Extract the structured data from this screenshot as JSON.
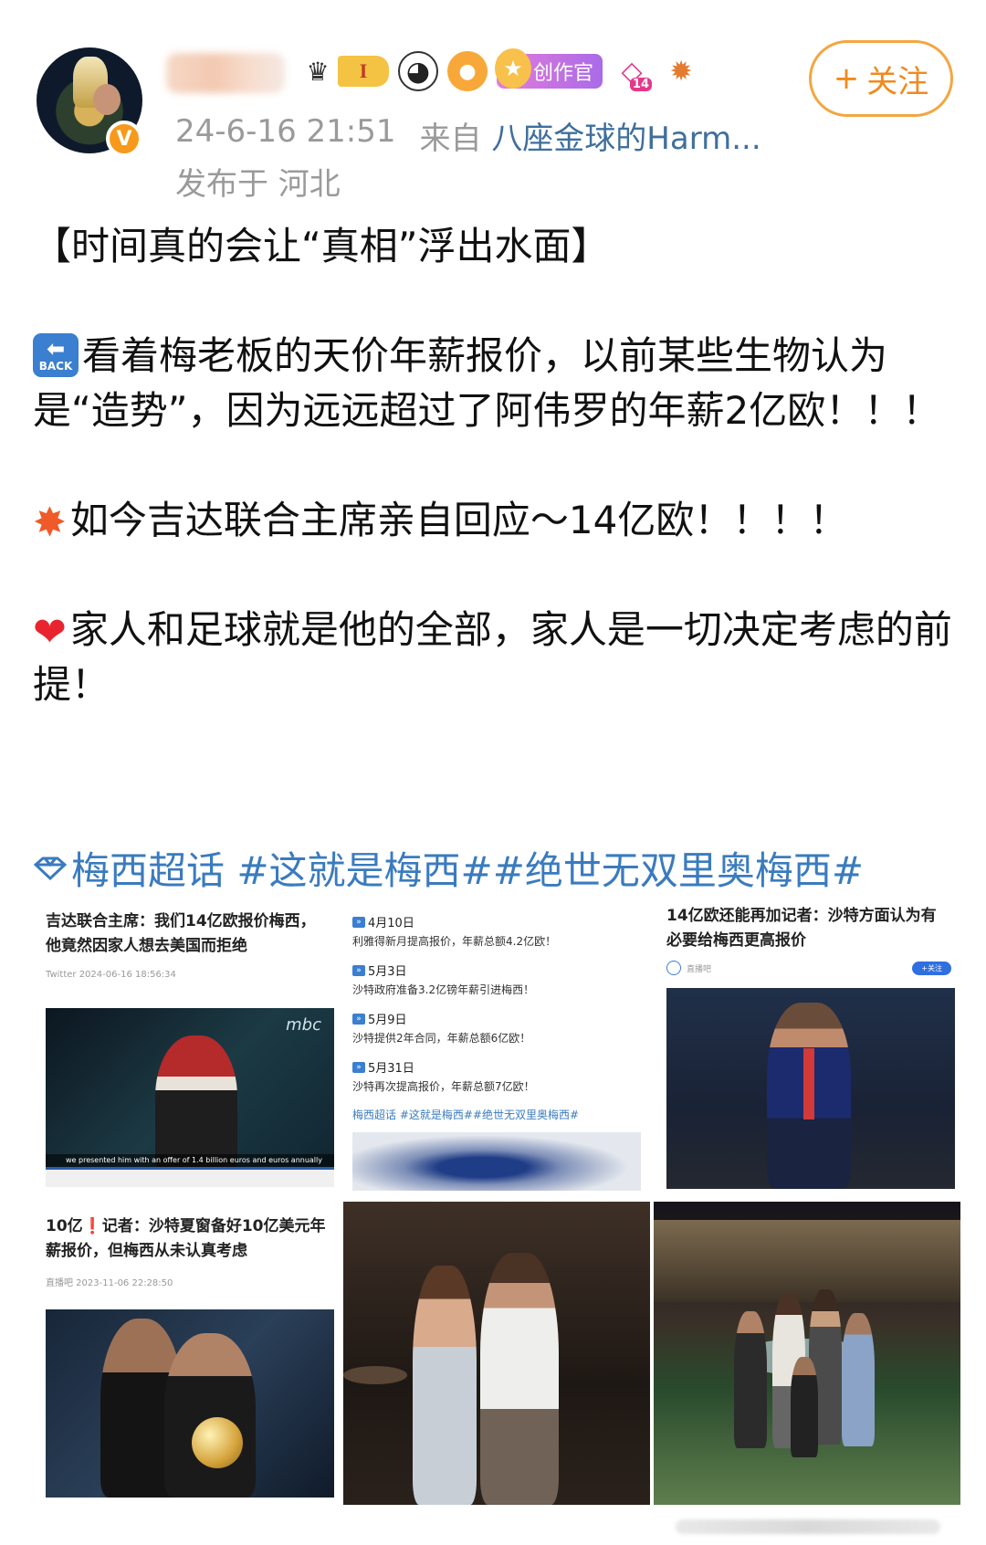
{
  "post": {
    "timestamp": "24-6-16 21:51",
    "source_prefix": "来自",
    "source": "八座金球的Harm...",
    "location": "发布于 河北",
    "follow_label": "关注",
    "follow_plus": "+",
    "badges": {
      "level": "I",
      "creator": "创作官",
      "gem_level": "14"
    },
    "verified_mark": "V",
    "paragraphs": {
      "p1": "【时间真的会让“真相”浮出水面】",
      "p2": "看着梅老板的天价年薪报价，以前某些生物认为是“造势”，因为远远超过了阿伟罗的年薪2亿欧！！！",
      "p3": "如今吉达联合主席亲自回应～14亿欧！！！！",
      "p4": "家人和足球就是他的全部，家人是一切决定考虑的前提！"
    },
    "back_icon_label": "BACK",
    "hashtags": "梅西超话 #这就是梅西##绝世无双里奥梅西#"
  },
  "images": {
    "tile1": {
      "title": "吉达联合主席：我们14亿欧报价梅西，他竟然因家人想去美国而拒绝",
      "source": "Twitter  2024-06-16 18:56:34",
      "caption": "we presented him with an offer of 1.4 billion euros and           euros annually",
      "logo": "mbc"
    },
    "tile2": {
      "items": [
        {
          "date": "4月10日",
          "text": "利雅得新月提高报价，年薪总额4.2亿欧！"
        },
        {
          "date": "5月3日",
          "text": "沙特政府准备3.2亿镑年薪引进梅西！"
        },
        {
          "date": "5月9日",
          "text": "沙特提供2年合同，年薪总额6亿欧！"
        },
        {
          "date": "5月31日",
          "text": "沙特再次提高报价，年薪总额7亿欧！"
        }
      ],
      "tags": "梅西超话 #这就是梅西##绝世无双里奥梅西#"
    },
    "tile3": {
      "title": "14亿欧还能再加记者：沙特方面认为有必要给梅西更高报价",
      "source": "直播吧",
      "follow": "+关注"
    },
    "tile4": {
      "title_prefix": "10亿",
      "title_alert": "❗",
      "title": "记者：沙特夏窗备好10亿美元年薪报价，但梅西从未认真考虑",
      "source": "直播吧  2023-11-06 22:28:50"
    }
  },
  "colors": {
    "link_blue": "#3a7bbf",
    "follow_orange": "#f08a1c",
    "meta_grey": "#9a9a9a"
  }
}
